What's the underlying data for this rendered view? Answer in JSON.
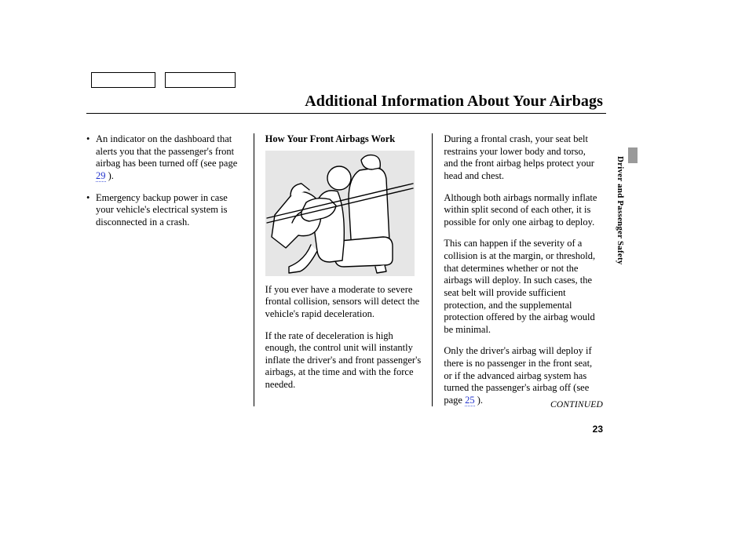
{
  "heading": "Additional Information About Your Airbags",
  "section_tab": "Driver and Passenger Safety",
  "col1": {
    "items": [
      {
        "pre": "An indicator on the dashboard that alerts you that the passenger's front airbag has been turned off (see page ",
        "link": "29",
        "post": " )."
      },
      {
        "pre": "Emergency backup power in case your vehicle's electrical system is disconnected in a crash.",
        "link": "",
        "post": ""
      }
    ]
  },
  "col2": {
    "subhead": "How Your Front Airbags Work",
    "p1": "If you ever have a moderate to severe frontal collision, sensors will detect the vehicle's rapid deceleration.",
    "p2": "If the rate of deceleration is high enough, the control unit will instantly inflate the driver's and front passenger's airbags, at the time and with the force needed."
  },
  "col3": {
    "p1": "During a frontal crash, your seat belt restrains your lower body and torso, and the front airbag helps protect your head and chest.",
    "p2": "Although both airbags normally inflate within split second of each other, it is possible for only one airbag to deploy.",
    "p3": "This can happen if the severity of a collision is at the margin, or threshold, that determines whether or not the airbags will deploy. In such cases, the seat belt will provide sufficient protection, and the supplemental protection offered by the airbag would be minimal.",
    "p4_pre": "Only the driver's airbag will deploy if there is no passenger in the front seat, or if the advanced airbag system has turned the passenger's airbag off (see page ",
    "p4_link": "25",
    "p4_post": " )."
  },
  "continued_label": "CONTINUED",
  "page_number": "23"
}
